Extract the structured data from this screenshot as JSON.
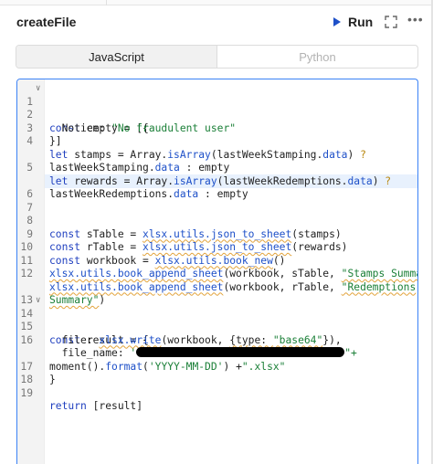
{
  "header": {
    "title": "createFile",
    "run_label": "Run"
  },
  "tabs": [
    {
      "label": "JavaScript",
      "active": true
    },
    {
      "label": "Python",
      "active": false
    }
  ],
  "colors": {
    "accent": "#1e50c8",
    "editor_border": "#3b82f6",
    "string": "#1a7f37",
    "keyword": "#1f3fbf"
  },
  "icons": [
    "play-icon",
    "expand-icon",
    "more-icon",
    "fold-arrow-icon"
  ],
  "code": {
    "line_numbers": [
      "1",
      "2",
      "3",
      "4",
      "",
      "5",
      "",
      "6",
      "7",
      "8",
      "9",
      "10",
      "11",
      "12",
      "",
      "13",
      "14",
      "15",
      "16",
      "",
      "17",
      "18",
      "19"
    ],
    "l1": {
      "a": "const",
      "b": " empty = [{"
    },
    "l2": {
      "a": "  Notice: ",
      "b": "\"No fraudulent user\""
    },
    "l3": "}]",
    "l4": {
      "a": "let",
      "b": " stamps = Array.",
      "c": "isArray",
      "d": "(lastWeekStamping.",
      "e": "data",
      "f": ") ",
      "g": "?"
    },
    "l4b": {
      "a": "lastWeekStamping.",
      "b": "data",
      "c": " : empty"
    },
    "l5": {
      "a": "let",
      "b": " rewards = Array.",
      "c": "isArray",
      "d": "(lastWeekRedemptions.",
      "e": "data",
      "f": ") ",
      "g": "?"
    },
    "l5b": {
      "a": "lastWeekRedemptions.",
      "b": "data",
      "c": " : empty"
    },
    "l8": {
      "a": "const",
      "b": " sTable = ",
      "c": "xlsx.utils.json_to_sheet",
      "d": "(stamps)"
    },
    "l9": {
      "a": "const",
      "b": " rTable = ",
      "c": "xlsx.utils.json_to_sheet",
      "d": "(rewards)"
    },
    "l10": {
      "a": "const",
      "b": " workbook = ",
      "c": "xlsx.utils.book_new",
      "d": "()"
    },
    "l11": {
      "a": "xlsx.utils.book_append_sheet",
      "b": "(workbook, sTable, ",
      "c": "\"Stamps Summary\"",
      "d": ")"
    },
    "l12": {
      "a": "xlsx.utils.book_append_sheet",
      "b": "(workbook, rTable, ",
      "c": "\"Redemptions"
    },
    "l12b": {
      "a": "Summary\"",
      "b": ")"
    },
    "l14": {
      "a": "const",
      "b": " result = {"
    },
    "l15": {
      "a": "  file: ",
      "b": "xlsx.write",
      "c": "(workbook, ",
      "d": "{type: ",
      "e": "\"base64\"",
      "f": "}),"
    },
    "l16": {
      "a": "  file_name: ",
      "b": "'",
      "c": "\"+"
    },
    "l16b": {
      "a": "moment().",
      "b": "format",
      "c": "(",
      "d": "'YYYY-MM-DD'",
      "e": ") +",
      "f": "\".xlsx\""
    },
    "l17": "}",
    "l19": {
      "a": "return",
      "b": " [result]"
    }
  }
}
